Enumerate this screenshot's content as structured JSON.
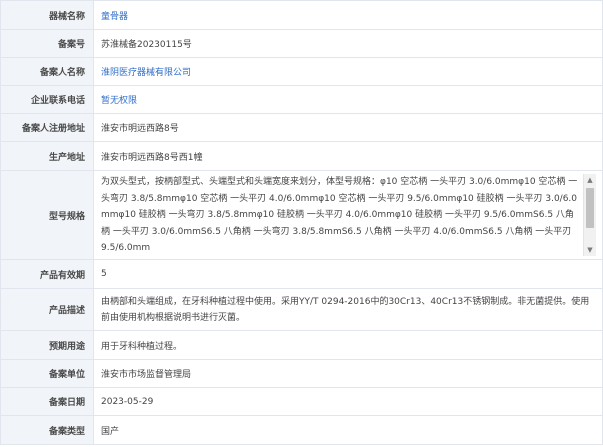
{
  "rows": [
    {
      "label": "器械名称",
      "value": "童骨器",
      "style": "link"
    },
    {
      "label": "备案号",
      "value": "苏淮械备20230115号",
      "style": "plain"
    },
    {
      "label": "备案人名称",
      "value": "淮阴医疗器械有限公司",
      "style": "link"
    },
    {
      "label": "企业联系电话",
      "value": "暂无权限",
      "style": "link"
    },
    {
      "label": "备案人注册地址",
      "value": "淮安市明远西路8号",
      "style": "plain"
    },
    {
      "label": "生产地址",
      "value": "淮安市明远西路8号西1幢",
      "style": "plain"
    },
    {
      "label": "型号规格",
      "value": "为双头型式，按柄部型式、头端型式和头端宽度来划分，体型号规格：φ10 空芯柄 一头平刃 3.0/6.0mmφ10 空芯柄 一头弯刃 3.8/5.8mmφ10 空芯柄 一头平刃 4.0/6.0mmφ10 空芯柄 一头平刃 9.5/6.0mmφ10 硅胶柄 一头平刃 3.0/6.0mmφ10 硅胶柄 一头弯刃 3.8/5.8mmφ10 硅胶柄 一头平刃 4.0/6.0mmφ10 硅胶柄 一头平刃 9.5/6.0mmS6.5 八角柄 一头平刃 3.0/6.0mmS6.5 八角柄 一头弯刃 3.8/5.8mmS6.5 八角柄 一头平刃 4.0/6.0mmS6.5 八角柄 一头平刃 9.5/6.0mm",
      "style": "scroll"
    },
    {
      "label": "产品有效期",
      "value": "5",
      "style": "plain"
    },
    {
      "label": "产品描述",
      "value": "由柄部和头端组成，在牙科种植过程中使用。采用YY/T 0294-2016中的30Cr13、40Cr13不锈钢制成。非无菌提供。使用前由使用机构根据说明书进行灭菌。",
      "style": "multi"
    },
    {
      "label": "预期用途",
      "value": "用于牙科种植过程。",
      "style": "plain"
    },
    {
      "label": "备案单位",
      "value": "淮安市市场监督管理局",
      "style": "plain"
    },
    {
      "label": "备案日期",
      "value": "2023-05-29",
      "style": "plain"
    },
    {
      "label": "备案类型",
      "value": "国产",
      "style": "plain"
    }
  ],
  "scrollbar": {
    "up_icon": "scroll-up-arrow-icon",
    "down_icon": "scroll-down-arrow-icon",
    "up_glyph": "▲",
    "down_glyph": "▼"
  }
}
